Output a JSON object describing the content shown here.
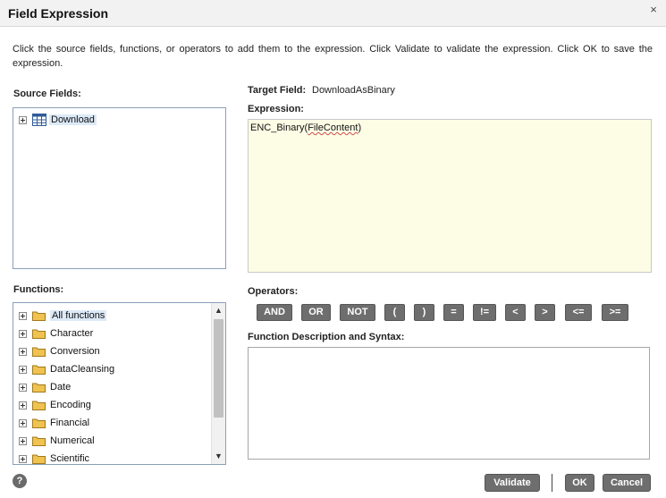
{
  "dialog": {
    "title": "Field Expression",
    "close_glyph": "×",
    "instructions": "Click the source fields, functions, or operators to add them to the expression. Click Validate to validate the expression. Click OK to save the expression."
  },
  "source_fields": {
    "label": "Source Fields:",
    "items": [
      {
        "label": "Download",
        "icon": "table-icon"
      }
    ]
  },
  "target": {
    "label": "Target Field:",
    "value": "DownloadAsBinary"
  },
  "expression": {
    "label": "Expression:",
    "prefix": "ENC_Binary(",
    "arg": "FileContent",
    "suffix": ")"
  },
  "functions": {
    "label": "Functions:",
    "items": [
      {
        "label": "All functions"
      },
      {
        "label": "Character"
      },
      {
        "label": "Conversion"
      },
      {
        "label": "DataCleansing"
      },
      {
        "label": "Date"
      },
      {
        "label": "Encoding"
      },
      {
        "label": "Financial"
      },
      {
        "label": "Numerical"
      },
      {
        "label": "Scientific"
      }
    ]
  },
  "operators": {
    "label": "Operators:",
    "items": [
      "AND",
      "OR",
      "NOT",
      "(",
      ")",
      "=",
      "!=",
      "<",
      ">",
      "<=",
      ">="
    ]
  },
  "description": {
    "label": "Function Description and Syntax:"
  },
  "buttons": {
    "validate": "Validate",
    "ok": "OK",
    "cancel": "Cancel",
    "help_glyph": "?"
  },
  "colors": {
    "expression_bg": "#fdfde6",
    "button_bg": "#6e6e6e",
    "folder": "#f0c250"
  }
}
